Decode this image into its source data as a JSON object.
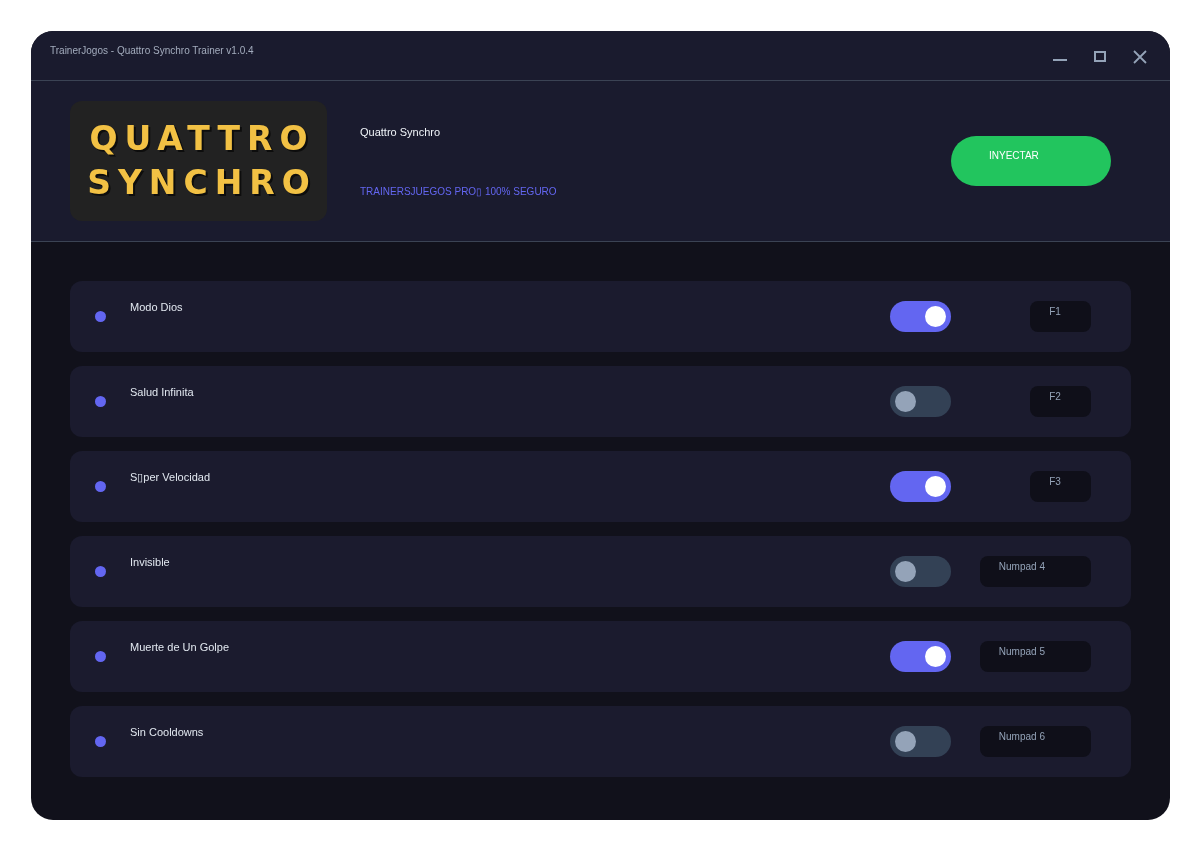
{
  "window": {
    "title": "TrainerJogos - Quattro Synchro Trainer v1.0.4"
  },
  "header": {
    "logo_lines": [
      "QUATTRO",
      "SYNCHRO"
    ],
    "game_title": "Quattro Synchro",
    "tagline": "TRAINERSJUEGOS PRO▯ 100% SEGURO",
    "inject_button": "INYECTAR"
  },
  "cheats": [
    {
      "name": "Modo Dios",
      "on": true,
      "hotkey": "F1"
    },
    {
      "name": "Salud Infinita",
      "on": false,
      "hotkey": "F2"
    },
    {
      "name": "S▯per Velocidad",
      "on": true,
      "hotkey": "F3"
    },
    {
      "name": "Invisible",
      "on": false,
      "hotkey": "Numpad 4"
    },
    {
      "name": "Muerte de Un Golpe",
      "on": true,
      "hotkey": "Numpad 5"
    },
    {
      "name": "Sin Cooldowns",
      "on": false,
      "hotkey": "Numpad 6"
    }
  ]
}
